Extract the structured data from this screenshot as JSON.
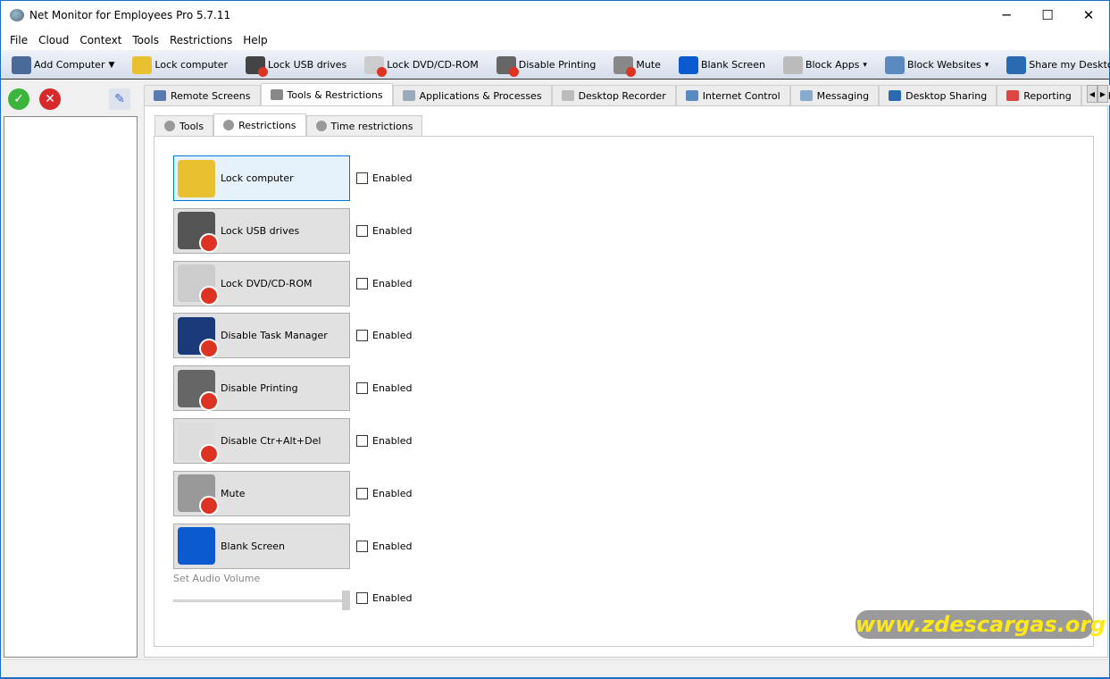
{
  "window": {
    "title": "Net Monitor for Employees Pro 5.7.11",
    "minimize": "─",
    "maximize": "☐",
    "close": "✕"
  },
  "menu": [
    "File",
    "Cloud",
    "Context",
    "Tools",
    "Restrictions",
    "Help"
  ],
  "toolbar": [
    {
      "label": "Add Computer",
      "icon": "monitor-add-icon",
      "color": "#4a6a9a",
      "dropdown": "▼"
    },
    {
      "label": "Lock computer",
      "icon": "padlock-icon",
      "color": "#e8c030"
    },
    {
      "label": "Lock USB drives",
      "icon": "usb-drive-icon",
      "color": "#444",
      "x": true
    },
    {
      "label": "Lock DVD/CD-ROM",
      "icon": "dvd-drive-icon",
      "color": "#ccc",
      "x": true
    },
    {
      "label": "Disable Printing",
      "icon": "printer-icon",
      "color": "#666",
      "x": true
    },
    {
      "label": "Mute",
      "icon": "speaker-icon",
      "color": "#888",
      "x": true
    },
    {
      "label": "Blank Screen",
      "icon": "blank-monitor-icon",
      "color": "#0a5ad0"
    },
    {
      "label": "Block Apps",
      "icon": "gears-icon",
      "color": "#bbb",
      "dropdown": "▾"
    },
    {
      "label": "Block Websites",
      "icon": "globe-icon",
      "color": "#5a8ac0",
      "dropdown": "▾"
    },
    {
      "label": "Share my Desktop",
      "icon": "share-desktop-icon",
      "color": "#2a6ab0"
    }
  ],
  "tabs": [
    {
      "label": "Remote Screens",
      "icon": "monitor-icon",
      "color": "#5a7ab0"
    },
    {
      "label": "Tools & Restrictions",
      "icon": "tools-icon",
      "color": "#888",
      "active": true
    },
    {
      "label": "Applications & Processes",
      "icon": "search-icon",
      "color": "#9ab"
    },
    {
      "label": "Desktop Recorder",
      "icon": "film-icon",
      "color": "#bbb"
    },
    {
      "label": "Internet Control",
      "icon": "globe-icon",
      "color": "#5a8ac0"
    },
    {
      "label": "Messaging",
      "icon": "chat-bubble-icon",
      "color": "#8ac"
    },
    {
      "label": "Desktop Sharing",
      "icon": "share-desktop-icon",
      "color": "#2a6ab0"
    },
    {
      "label": "Reporting",
      "icon": "bar-chart-icon",
      "color": "#d44"
    },
    {
      "label": "File Mar",
      "icon": "folder-icon",
      "color": "#e8d890"
    }
  ],
  "tab_scroll": {
    "left": "◀",
    "right": "▶"
  },
  "subtabs": [
    {
      "label": "Tools",
      "icon": "tools-icon"
    },
    {
      "label": "Restrictions",
      "icon": "shield-icon",
      "active": true
    },
    {
      "label": "Time restrictions",
      "icon": "stopwatch-icon"
    }
  ],
  "restrictions": [
    {
      "label": "Lock computer",
      "icon": "padlock-icon",
      "color": "#e8c030",
      "x": false,
      "checkbox": "Enabled",
      "checked": false
    },
    {
      "label": "Lock USB drives",
      "icon": "usb-drive-icon",
      "color": "#555",
      "x": true,
      "checkbox": "Enabled",
      "checked": false
    },
    {
      "label": "Lock DVD/CD-ROM",
      "icon": "dvd-drive-icon",
      "color": "#ccc",
      "x": true,
      "checkbox": "Enabled",
      "checked": false
    },
    {
      "label": "Disable Task Manager",
      "icon": "task-manager-icon",
      "color": "#1a3a7a",
      "x": true,
      "checkbox": "Enabled",
      "checked": false
    },
    {
      "label": "Disable Printing",
      "icon": "printer-icon",
      "color": "#666",
      "x": true,
      "checkbox": "Enabled",
      "checked": false
    },
    {
      "label": "Disable Ctr+Alt+Del",
      "icon": "keyboard-keys-icon",
      "color": "#ddd",
      "x": true,
      "checkbox": "Enabled",
      "checked": false
    },
    {
      "label": "Mute",
      "icon": "speaker-icon",
      "color": "#999",
      "x": true,
      "checkbox": "Enabled",
      "checked": false
    },
    {
      "label": "Blank Screen",
      "icon": "blank-monitor-icon",
      "color": "#0a5ad0",
      "x": false,
      "checkbox": "Enabled",
      "checked": false
    }
  ],
  "volume": {
    "label": "Set Audio Volume",
    "level_percent": 100,
    "checkbox": "Enabled",
    "checked": false
  },
  "watermark": "www.zdescargas.org"
}
